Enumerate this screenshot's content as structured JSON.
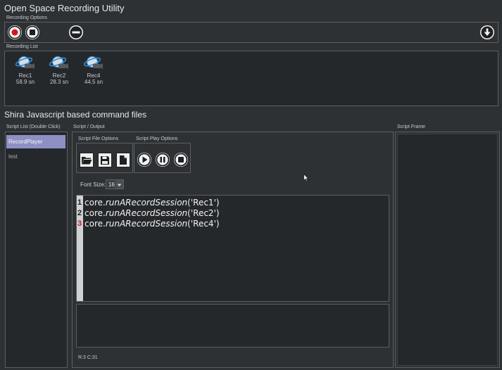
{
  "app": {
    "title": "Open Space Recording Utility"
  },
  "recording_options": {
    "label": "Recording Options",
    "record_icon": "record-icon",
    "stop_icon": "stop-icon",
    "remove_icon": "minus-icon",
    "download_icon": "download-icon"
  },
  "recording_list": {
    "label": "Recording List",
    "items": [
      {
        "name": "Rec1",
        "size": "58.9 sn"
      },
      {
        "name": "Rec2",
        "size": "28.3 sn"
      },
      {
        "name": "Rec4",
        "size": "44.5 sn"
      }
    ]
  },
  "section_title": "Shira Javascript based command files",
  "script_list": {
    "label": "Script List (Double Click)",
    "items": [
      {
        "name": "RecordPlayer",
        "selected": true
      },
      {
        "name": "test",
        "selected": false
      }
    ]
  },
  "script_output": {
    "label": "Script / Output",
    "file_options_label": "Script File Options",
    "play_options_label": "Script Play Options",
    "font_size_label": "Font Size:",
    "font_size_value": "16",
    "code_lines": [
      {
        "num": "1",
        "obj": "core.",
        "fn": "runARecordSession",
        "arg": "('Rec1')",
        "error": false
      },
      {
        "num": "2",
        "obj": "core.",
        "fn": "runARecordSession",
        "arg": "('Rec2')",
        "error": false
      },
      {
        "num": "3",
        "obj": "core.",
        "fn": "runARecordSession",
        "arg": "('Rec4')",
        "error": true
      }
    ],
    "cursor_status": "R:3 C:31"
  },
  "script_frame": {
    "label": "Script Frame"
  },
  "colors": {
    "background": "#2e3134",
    "panel_dark": "#25282b",
    "selected_item": "#8e90c4",
    "record_red": "#d8141d",
    "error_line_number": "#d8141d"
  }
}
